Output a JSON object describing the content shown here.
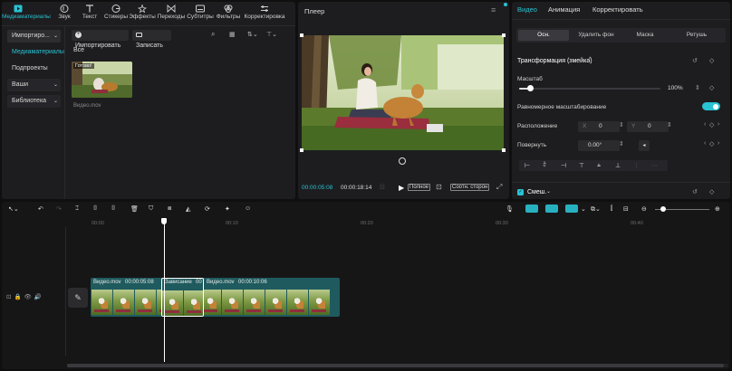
{
  "toolbar": {
    "items": [
      {
        "label": "Медиаматериалы",
        "icon": "media-icon"
      },
      {
        "label": "Звук",
        "icon": "audio-icon"
      },
      {
        "label": "Текст",
        "icon": "text-icon"
      },
      {
        "label": "Стикеры",
        "icon": "sticker-icon"
      },
      {
        "label": "Эффекты",
        "icon": "effects-icon"
      },
      {
        "label": "Переходы",
        "icon": "transitions-icon"
      },
      {
        "label": "Субтитры",
        "icon": "subtitles-icon"
      },
      {
        "label": "Фильтры",
        "icon": "filters-icon"
      },
      {
        "label": "Корректировка",
        "icon": "adjust-icon"
      }
    ]
  },
  "sidebar": {
    "items": [
      {
        "label": "Импортиро..."
      },
      {
        "label": "Медиаматериалы"
      },
      {
        "label": "Подпроекты"
      },
      {
        "label": "Ваши"
      },
      {
        "label": "Библиотека"
      }
    ]
  },
  "media": {
    "import_label": "Импортировать",
    "record_label": "Записать",
    "filter_all": "Все",
    "thumb_badge": "Готово!",
    "thumb_name": "Видео.mov"
  },
  "player": {
    "title": "Плеер",
    "time_current": "00:00:05:08",
    "time_total": "00:00:18:14",
    "quality_label": "Полное",
    "ratio_label": "Соотн. сторон"
  },
  "props": {
    "tabs": [
      "Видео",
      "Анимация",
      "Корректировать"
    ],
    "subtabs": [
      "Осн.",
      "Удалить фон",
      "Маска",
      "Ретушь"
    ],
    "section_title": "Трансформация (змейка)",
    "scale_label": "Масштаб",
    "scale_value": "100%",
    "scale_fraction": 0.08,
    "uniform_label": "Равномерное масштабирование",
    "position_label": "Расположение",
    "x_label": "X",
    "x_value": "0",
    "y_label": "Y",
    "y_value": "0",
    "rotate_label": "Повернуть",
    "rotate_value": "0.00°",
    "blend_label": "Смеш.",
    "accent": "#29c2d3"
  },
  "timeline": {
    "ruler": [
      "00:00",
      "00:10",
      "00:20",
      "00:30",
      "00:40"
    ],
    "clip1_label": "Видео.mov",
    "clip1_time": "00:00:05:08",
    "freeze_label": "Зависание",
    "freeze_time": "00",
    "clip2_label": "Видео.mov",
    "clip2_time": "00:00:10:06",
    "clip_color": "#1f5b5e"
  }
}
